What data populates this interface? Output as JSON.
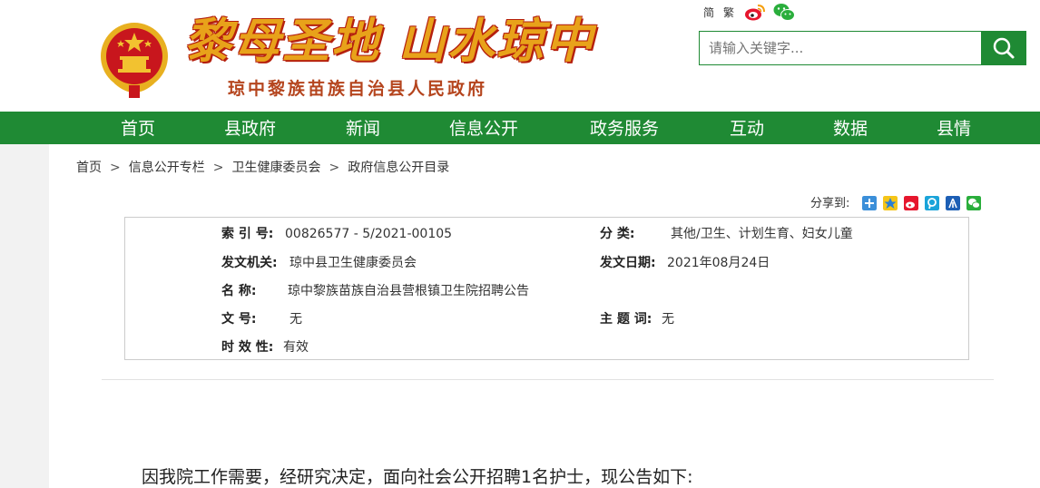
{
  "header": {
    "slogan": "黎母圣地 山水琼中",
    "site_name": "琼中黎族苗族自治县人民政府",
    "lang_simplified": "简",
    "lang_traditional": "繁",
    "search_placeholder": "请输入关键字..."
  },
  "nav": {
    "items": [
      "首页",
      "县政府",
      "新闻",
      "信息公开",
      "政务服务",
      "互动",
      "数据",
      "县情"
    ]
  },
  "breadcrumb": {
    "items": [
      "首页",
      "信息公开专栏",
      "卫生健康委员会",
      "政府信息公开目录"
    ],
    "separator": ">"
  },
  "share": {
    "label": "分享到:"
  },
  "info": {
    "index_label": "索 引 号:",
    "index_value": "00826577 - 5/2021-00105",
    "category_label": "分      类:",
    "category_value": "其他/卫生、计划生育、妇女儿童",
    "issuer_label": "发文机关:",
    "issuer_value": "琼中县卫生健康委员会",
    "date_label": "发文日期:",
    "date_value": "2021年08月24日",
    "name_label": "名      称:",
    "name_value": "琼中黎族苗族自治县营根镇卫生院招聘公告",
    "docno_label": "文      号:",
    "docno_value": "无",
    "subject_label": "主 题 词:",
    "subject_value": "无",
    "validity_label": "时 效 性:",
    "validity_value": "有效"
  },
  "content": {
    "first_line": "因我院工作需要，经研究决定，面向社会公开招聘1名护士，现公告如下:"
  },
  "colors": {
    "primary_green": "#1f8a34",
    "slogan_gold": "#e8a21a",
    "emblem_red": "#c8161d"
  }
}
